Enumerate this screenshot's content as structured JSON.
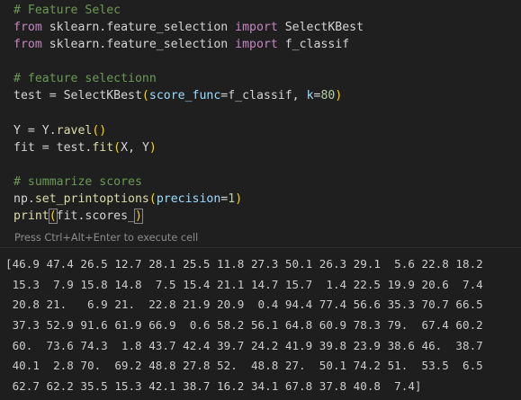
{
  "code_lines": [
    [
      {
        "t": "# Feature Selec",
        "c": "c-comment"
      }
    ],
    [
      {
        "t": "from",
        "c": "c-kw"
      },
      {
        "t": " sklearn.feature_selection "
      },
      {
        "t": "import",
        "c": "c-kw"
      },
      {
        "t": " SelectKBest"
      }
    ],
    [
      {
        "t": "from",
        "c": "c-kw"
      },
      {
        "t": " sklearn.feature_selection "
      },
      {
        "t": "import",
        "c": "c-kw"
      },
      {
        "t": " f_classif"
      }
    ],
    [],
    [
      {
        "t": "# feature selectionn",
        "c": "c-comment"
      }
    ],
    [
      {
        "t": "test = SelectKBest"
      },
      {
        "t": "(",
        "c": "c-br1"
      },
      {
        "t": "score_func",
        "c": "c-param"
      },
      {
        "t": "=f_classif, "
      },
      {
        "t": "k",
        "c": "c-param"
      },
      {
        "t": "="
      },
      {
        "t": "80",
        "c": "c-num"
      },
      {
        "t": ")",
        "c": "c-br1"
      }
    ],
    [],
    [
      {
        "t": "Y = Y."
      },
      {
        "t": "ravel",
        "c": "c-fn"
      },
      {
        "t": "()",
        "c": "c-br1"
      }
    ],
    [
      {
        "t": "fit = test."
      },
      {
        "t": "fit",
        "c": "c-fn"
      },
      {
        "t": "(",
        "c": "c-br1"
      },
      {
        "t": "X, Y"
      },
      {
        "t": ")",
        "c": "c-br1"
      }
    ],
    [],
    [
      {
        "t": "# summarize scores",
        "c": "c-comment"
      }
    ],
    [
      {
        "t": "np."
      },
      {
        "t": "set_printoptions",
        "c": "c-fn"
      },
      {
        "t": "(",
        "c": "c-br1"
      },
      {
        "t": "precision",
        "c": "c-param"
      },
      {
        "t": "="
      },
      {
        "t": "1",
        "c": "c-num"
      },
      {
        "t": ")",
        "c": "c-br1"
      }
    ],
    [
      {
        "t": "print",
        "c": "c-fn"
      },
      {
        "t": "(",
        "c": "c-br1 cursor-bracket"
      },
      {
        "t": "fit.scores_"
      },
      {
        "t": ")",
        "c": "c-br1 cursor-bracket"
      }
    ]
  ],
  "hint_text": "Press Ctrl+Alt+Enter to execute cell",
  "output_lines": [
    "[46.9 47.4 26.5 12.7 28.1 25.5 11.8 27.3 50.1 26.3 29.1  5.6 22.8 18.2",
    " 15.3  7.9 15.8 14.8  7.5 15.4 21.1 14.7 15.7  1.4 22.5 19.9 20.6  7.4",
    " 20.8 21.   6.9 21.  22.8 21.9 20.9  0.4 94.4 77.4 56.6 35.3 70.7 66.5",
    " 37.3 52.9 91.6 61.9 66.9  0.6 58.2 56.1 64.8 60.9 78.3 79.  67.4 60.2",
    " 60.  73.6 74.3  1.8 43.7 42.4 39.7 24.2 41.9 39.8 23.9 38.6 46.  38.7",
    " 40.1  2.8 70.  69.2 48.8 27.8 52.  48.8 27.  50.1 74.2 51.  53.5  6.5",
    " 62.7 62.2 35.5 15.3 42.1 38.7 16.2 34.1 67.8 37.8 40.8  7.4]"
  ]
}
